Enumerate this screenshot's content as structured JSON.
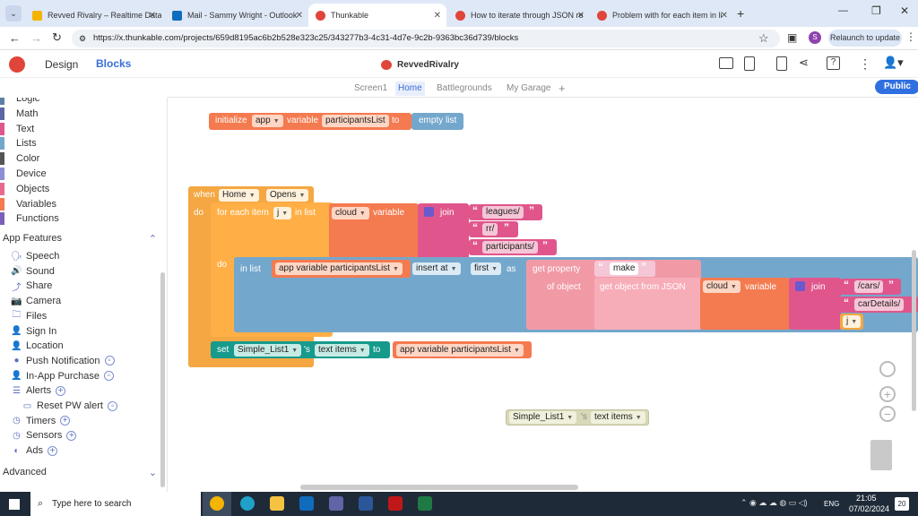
{
  "browser": {
    "tabs": [
      {
        "title": "Revved Rivalry – Realtime Datab",
        "color": "#f4b400"
      },
      {
        "title": "Mail - Sammy Wright - Outlook",
        "color": "#0f6cbd"
      },
      {
        "title": "Thunkable",
        "color": "#e0453a"
      },
      {
        "title": "How to iterate through JSON re",
        "color": "#e0453a"
      },
      {
        "title": "Problem with for each item in li",
        "color": "#e0453a"
      }
    ],
    "url": "https://x.thunkable.com/projects/659d8195ac6b2b528e323c25/343277b3-4c31-4d7e-9c2b-9363bc36d739/blocks",
    "relaunch": "Relaunch to update",
    "avatar": "S"
  },
  "app": {
    "design_tab": "Design",
    "blocks_tab": "Blocks",
    "project_name": "RevvedRivalry",
    "public_button": "Public",
    "screens": [
      "Screen1",
      "Home",
      "Battlegrounds",
      "My Garage"
    ],
    "add_screen": "+"
  },
  "sidebar": {
    "categories": [
      {
        "label": "Logic",
        "color": "#5b80a5"
      },
      {
        "label": "Math",
        "color": "#5b67a5"
      },
      {
        "label": "Text",
        "color": "#e0568c"
      },
      {
        "label": "Lists",
        "color": "#74a7cc"
      },
      {
        "label": "Color",
        "color": "#555555"
      },
      {
        "label": "Device",
        "color": "#8b8fd6"
      },
      {
        "label": "Objects",
        "color": "#e86a8f"
      },
      {
        "label": "Variables",
        "color": "#f47a50"
      },
      {
        "label": "Functions",
        "color": "#7b5fb8"
      }
    ],
    "app_features_label": "App Features",
    "features": [
      {
        "label": "Speech",
        "icon": "speech-icon",
        "glyph": "🗣"
      },
      {
        "label": "Sound",
        "icon": "sound-icon",
        "glyph": "🔊"
      },
      {
        "label": "Share",
        "icon": "share-icon",
        "glyph": "⤴"
      },
      {
        "label": "Camera",
        "icon": "camera-icon",
        "glyph": "📷"
      },
      {
        "label": "Files",
        "icon": "files-icon",
        "glyph": "🗀"
      },
      {
        "label": "Sign In",
        "icon": "sign-in-icon",
        "glyph": "👤"
      },
      {
        "label": "Location",
        "icon": "location-icon",
        "glyph": "👤"
      },
      {
        "label": "Push Notification",
        "icon": "push-notification-icon",
        "glyph": "●"
      },
      {
        "label": "In-App Purchase",
        "icon": "in-app-purchase-icon",
        "glyph": "👤"
      },
      {
        "label": "Alerts",
        "icon": "alerts-icon",
        "glyph": "☰"
      }
    ],
    "alert_child": "Reset PW alert",
    "more_features": [
      {
        "label": "Timers",
        "icon": "timers-icon",
        "glyph": "◷"
      },
      {
        "label": "Sensors",
        "icon": "sensors-icon",
        "glyph": "◷"
      },
      {
        "label": "Ads",
        "icon": "ads-icon",
        "glyph": "◐"
      }
    ],
    "advanced_label": "Advanced"
  },
  "blocks": {
    "init": {
      "initialize": "initialize",
      "scope": "app",
      "variable": "variable",
      "name": "participantsList",
      "to": "to",
      "empty": "empty list"
    },
    "event": {
      "when": "when",
      "screen": "Home",
      "event": "Opens",
      "do": "do"
    },
    "foreach": {
      "label": "for each item",
      "var": "j",
      "inlist": "in list",
      "cloud": "cloud",
      "variable": "variable",
      "join": "join",
      "do": "do"
    },
    "join_parts": [
      "leagues/",
      "rr/",
      "participants/"
    ],
    "insert": {
      "inlist": "in list",
      "listvar": "app variable participantsList",
      "insertat": "insert at",
      "first": "first",
      "as": "as"
    },
    "getprop": {
      "label": "get property",
      "prop": "make",
      "ofobject": "of object",
      "getobj": "get object from JSON",
      "cloud": "cloud",
      "variable": "variable",
      "join": "join",
      "parts": [
        "/cars/",
        "carDetails/"
      ],
      "jvar": "j"
    },
    "set": {
      "set": "set",
      "component": "Simple_List1",
      "s": "'s",
      "prop": "text items",
      "to": "to",
      "value": "app variable participantsList"
    },
    "loose": {
      "component": "Simple_List1",
      "s": "'s",
      "prop": "text items"
    }
  },
  "taskbar": {
    "search_placeholder": "Type here to search",
    "time": "21:05",
    "date": "07/02/2024",
    "lang": "ENG",
    "notif": "20"
  }
}
